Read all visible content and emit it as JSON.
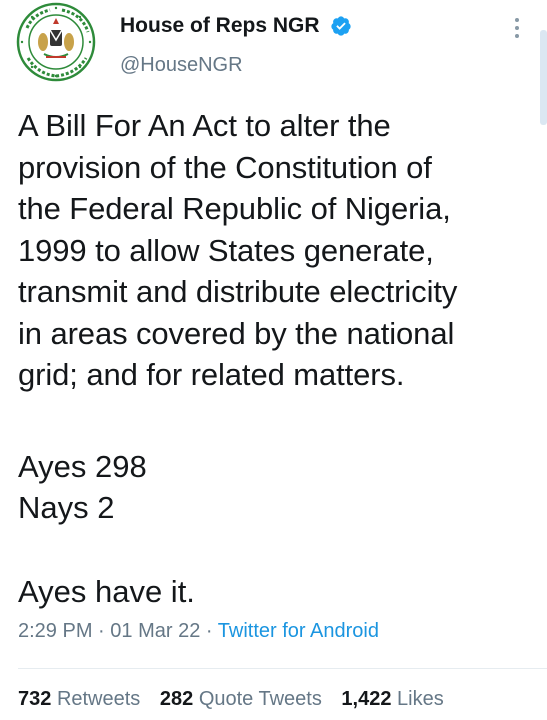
{
  "author": {
    "display_name": "House of Reps NGR",
    "handle": "@HouseNGR",
    "verified": true,
    "avatar_icon": "house-of-representatives-seal",
    "avatar_seal_text": "HOUSE OF REPRESENTATIVES · FEDERAL REPUBLIC OF NIGERIA"
  },
  "tweet": {
    "text": "A Bill For An Act to alter the\nprovision of the Constitution of\nthe Federal Republic of Nigeria,\n1999 to allow States generate,\ntransmit and distribute electricity\nin areas covered by the national\ngrid; and for related matters.",
    "ayes_line": "Ayes  298",
    "nays_line": "Nays 2",
    "result_line": "Ayes have it."
  },
  "meta": {
    "time": "2:29 PM",
    "separator": "·",
    "date": "01 Mar 22",
    "source": "Twitter for Android"
  },
  "stats": {
    "retweets_count": "732",
    "retweets_label": "Retweets",
    "quote_count": "282",
    "quote_label": "Quote Tweets",
    "likes_count": "1,422",
    "likes_label": "Likes"
  },
  "colors": {
    "text": "#14171a",
    "secondary": "#657786",
    "link": "#1b95e0",
    "verified": "#1da1f2",
    "seal_green": "#2e8b3a"
  }
}
